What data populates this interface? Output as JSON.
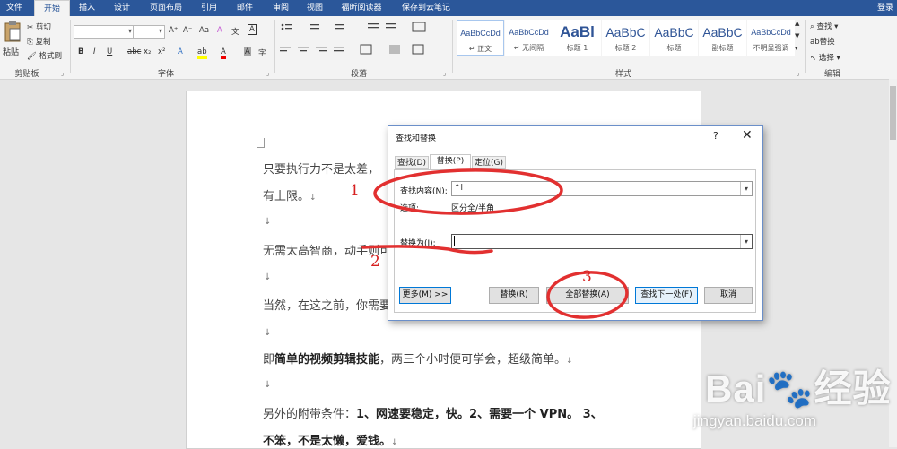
{
  "tabs": [
    "文件",
    "开始",
    "插入",
    "设计",
    "页面布局",
    "引用",
    "邮件",
    "审阅",
    "视图",
    "福昕阅读器",
    "保存到云笔记"
  ],
  "login": "登录",
  "clipboard": {
    "paste": "粘贴",
    "cut": "剪切",
    "copy": "复制",
    "format_painter": "格式刷",
    "group": "剪贴板"
  },
  "font": {
    "group": "字体",
    "bold": "B",
    "italic": "I",
    "underline": "U",
    "strike": "abc",
    "sub": "x₂",
    "sup": "x²",
    "grow": "A⁺",
    "shrink": "A⁻",
    "aa": "Aa",
    "clear": "A",
    "phonetic": "文",
    "box": "A",
    "effect": "A",
    "highlight": "ab",
    "color": "A",
    "shade": "A",
    "circle": "字"
  },
  "paragraph": {
    "group": "段落"
  },
  "styles": {
    "group": "样式",
    "items": [
      {
        "sample": "AaBbCcDd",
        "name": "↵ 正文"
      },
      {
        "sample": "AaBbCcDd",
        "name": "↵ 无间隔"
      },
      {
        "sample": "AaBl",
        "name": "标题 1"
      },
      {
        "sample": "AaBbC",
        "name": "标题 2"
      },
      {
        "sample": "AaBbC",
        "name": "标题"
      },
      {
        "sample": "AaBbC",
        "name": "副标题"
      },
      {
        "sample": "AaBbCcDd",
        "name": "不明显强调"
      }
    ]
  },
  "editing": {
    "group": "编辑",
    "find": "查找",
    "replace": "替换",
    "select": "选择"
  },
  "document": {
    "line1": "只要执行力不是太差，",
    "line2": "有上限。",
    "line3": "无需太高智商，动手则可",
    "line4": "当然，在这之前，你需要",
    "line5_pre": "即",
    "line5_bold": "简单的视频剪辑技能",
    "line5_post": "，两三个小时便可学会，超级简单。",
    "line6_pre": "另外的附带条件：",
    "line6_bold": "1、网速要稳定，快。2、需要一个 VPN。 3、",
    "line7_bold": "不笨，不是太懒，爱钱。",
    "mark": "↓"
  },
  "dialog": {
    "title": "查找和替换",
    "help": "?",
    "close": "✕",
    "tab_find": "查找(D)",
    "tab_replace": "替换(P)",
    "tab_goto": "定位(G)",
    "find_label": "查找内容(N):",
    "find_value": "^l",
    "options_label": "选项:",
    "options_value": "区分全/半角",
    "replace_label": "替换为(I):",
    "replace_value": "",
    "more": "更多(M) >>",
    "replace_btn": "替换(R)",
    "replace_all": "全部替换(A)",
    "find_next": "查找下一处(F)",
    "cancel": "取消"
  },
  "annotations": {
    "n1": "1",
    "n2": "2",
    "n3": "3",
    "color": "#d62020"
  },
  "watermark": {
    "logo": "Bai🐾经验",
    "url": "jingyan.baidu.com"
  },
  "colors": {
    "title_bar": "#2b579a",
    "annotation": "#d62020"
  }
}
